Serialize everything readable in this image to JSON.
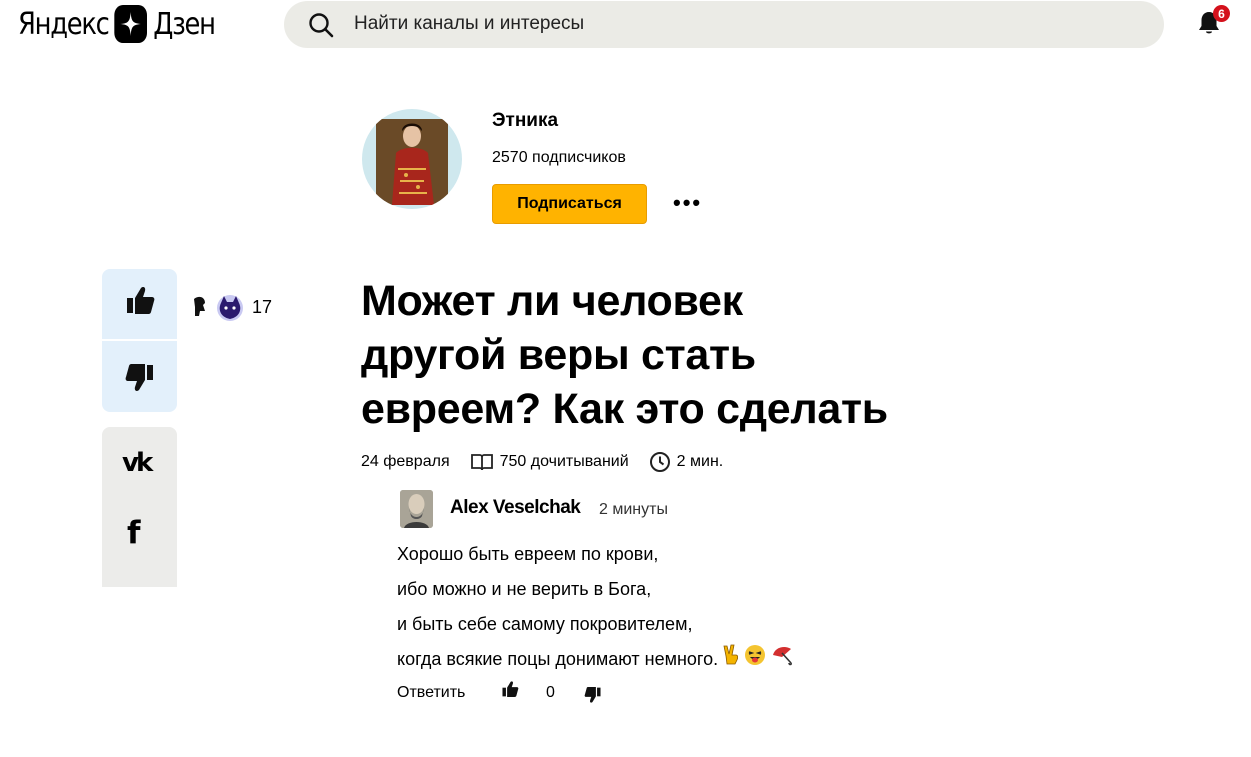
{
  "header": {
    "logo_left": "Яндекс",
    "logo_right": "Дзен",
    "search_placeholder": "Найти каналы и интересы",
    "notifications_count": "6"
  },
  "channel": {
    "name": "Этника",
    "subscribers": "2570 подписчиков",
    "subscribe_label": "Подписаться",
    "more_label": "•••"
  },
  "side": {
    "like_count": "17",
    "vk_label": "vk",
    "fb_label": "f"
  },
  "article": {
    "title_lines": [
      "Может ли человек",
      "другой веры стать",
      "евреем? Как это сделать"
    ],
    "date": "24 февраля",
    "reads": "750 дочитываний",
    "read_time": "2 мин."
  },
  "comment": {
    "author": "Alex Veselchak",
    "time": "2 минуты",
    "lines": [
      "Хорошо быть евреем по крови,",
      "ибо можно и не верить в Бога,",
      "и быть себе самому покровителем,",
      "когда всякие поцы донимают немного."
    ],
    "reply_label": "Ответить",
    "like_count": "0"
  },
  "colors": {
    "subscribe_bg": "#ffb300",
    "search_bg": "#ebebe6",
    "vote_bg": "#e3f0fb",
    "share_bg": "#ececea",
    "badge_bg": "#d4111c"
  }
}
